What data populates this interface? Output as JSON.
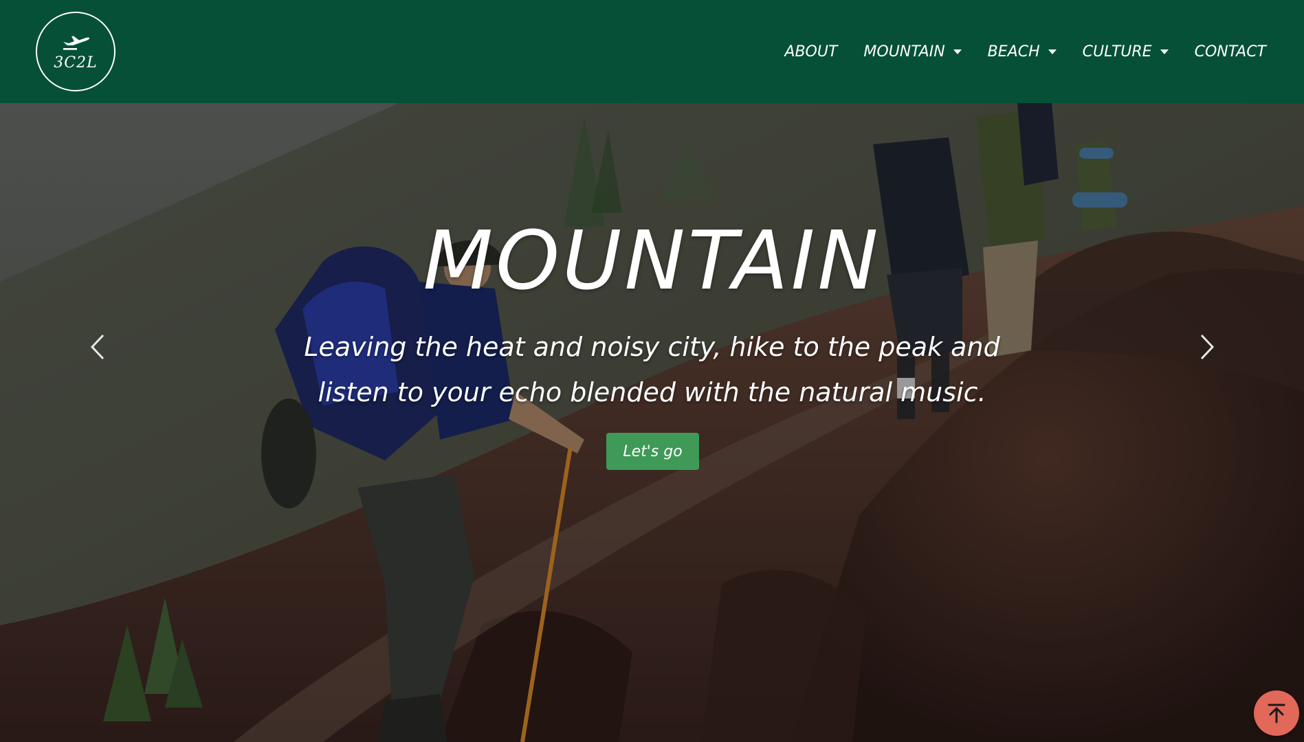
{
  "brand": {
    "logo_text": "3C2L",
    "icon": "airplane-icon"
  },
  "nav": {
    "items": [
      {
        "label": "ABOUT",
        "dropdown": false
      },
      {
        "label": "MOUNTAIN",
        "dropdown": true
      },
      {
        "label": "BEACH",
        "dropdown": true
      },
      {
        "label": "CULTURE",
        "dropdown": true
      },
      {
        "label": "CONTACT",
        "dropdown": false
      }
    ]
  },
  "hero": {
    "title": "MOUNTAIN",
    "subtitle": "Leaving the heat and noisy city, hike to the peak and listen to your echo blended with the natural music.",
    "cta_label": "Let's go",
    "prev_icon": "chevron-left-icon",
    "next_icon": "chevron-right-icon"
  },
  "scroll_top": {
    "icon": "arrow-up-to-top-icon"
  },
  "colors": {
    "navbar": "#065038",
    "cta": "#3f9a57",
    "scroll_top": "#e2685a",
    "text": "#ffffff"
  }
}
